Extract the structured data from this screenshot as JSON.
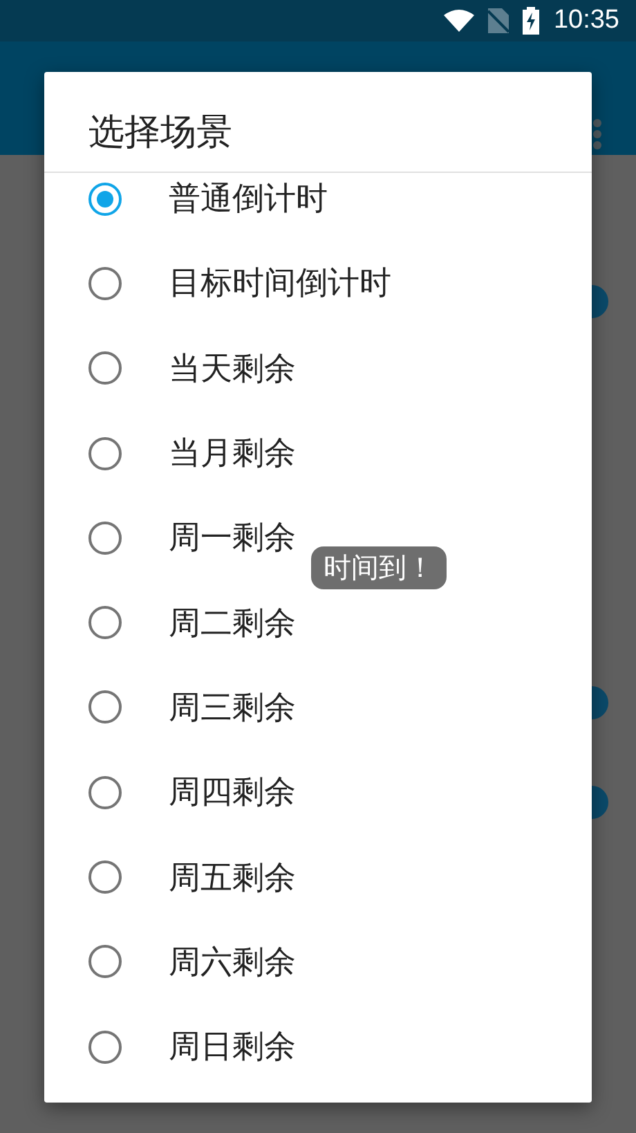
{
  "status_bar": {
    "time": "10:35"
  },
  "dialog": {
    "title": "选择场景",
    "options": [
      {
        "label": "普通倒计时",
        "selected": true
      },
      {
        "label": "目标时间倒计时",
        "selected": false
      },
      {
        "label": "当天剩余",
        "selected": false
      },
      {
        "label": "当月剩余",
        "selected": false
      },
      {
        "label": "周一剩余",
        "selected": false
      },
      {
        "label": "周二剩余",
        "selected": false
      },
      {
        "label": "周三剩余",
        "selected": false
      },
      {
        "label": "周四剩余",
        "selected": false
      },
      {
        "label": "周五剩余",
        "selected": false
      },
      {
        "label": "周六剩余",
        "selected": false
      },
      {
        "label": "周日剩余",
        "selected": false
      }
    ]
  },
  "toast": {
    "text": "时间到！"
  }
}
